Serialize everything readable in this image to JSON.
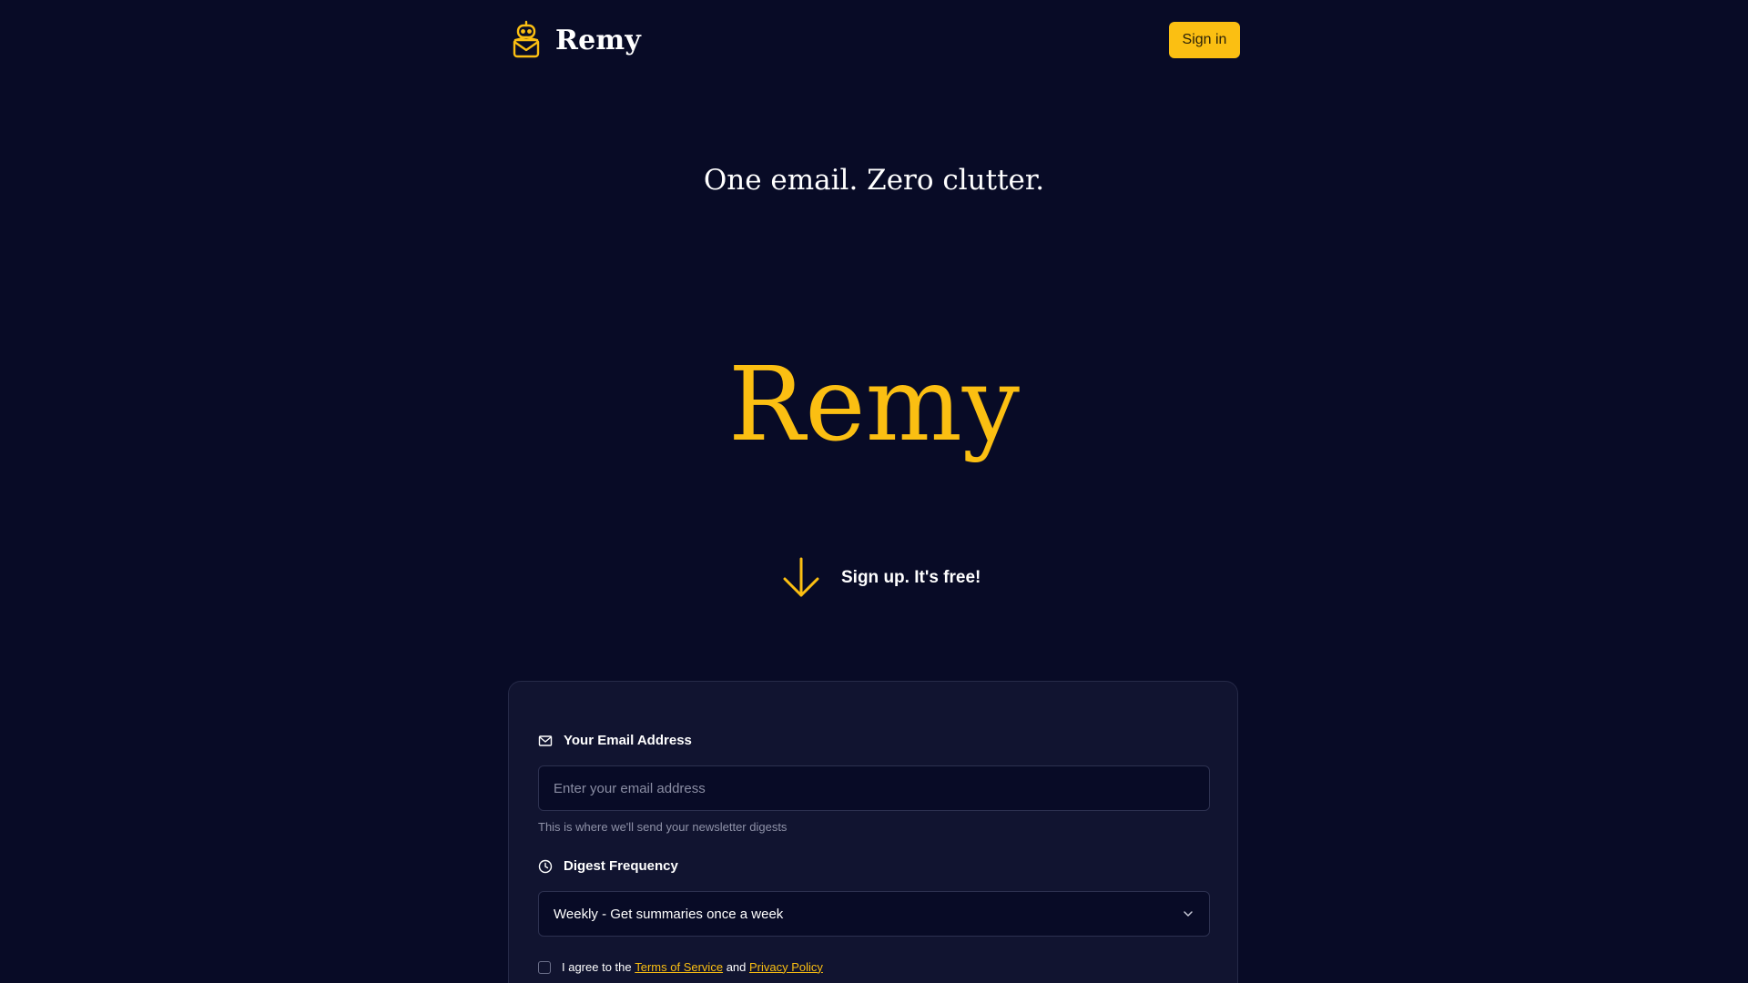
{
  "header": {
    "brand": "Remy",
    "logo_icon": "robot-mail-icon",
    "signin_label": "Sign in"
  },
  "hero": {
    "tagline": "One email. Zero clutter.",
    "title": "Remy",
    "cta_icon": "arrow-down-icon",
    "cta_text": "Sign up. It's free!"
  },
  "form": {
    "email": {
      "icon": "envelope-icon",
      "label": "Your Email Address",
      "placeholder": "Enter your email address",
      "value": "",
      "helper": "This is where we'll send your newsletter digests"
    },
    "frequency": {
      "icon": "clock-icon",
      "label": "Digest Frequency",
      "selected": "Weekly - Get summaries once a week"
    },
    "agreement": {
      "checked": false,
      "prefix": "I agree to the",
      "terms_link": "Terms of Service",
      "middle": "and",
      "privacy_link": "Privacy Policy"
    }
  },
  "colors": {
    "background": "#080b26",
    "card": "#111430",
    "accent": "#fbbf12",
    "text": "#ffffff",
    "muted": "#8f92a8"
  }
}
